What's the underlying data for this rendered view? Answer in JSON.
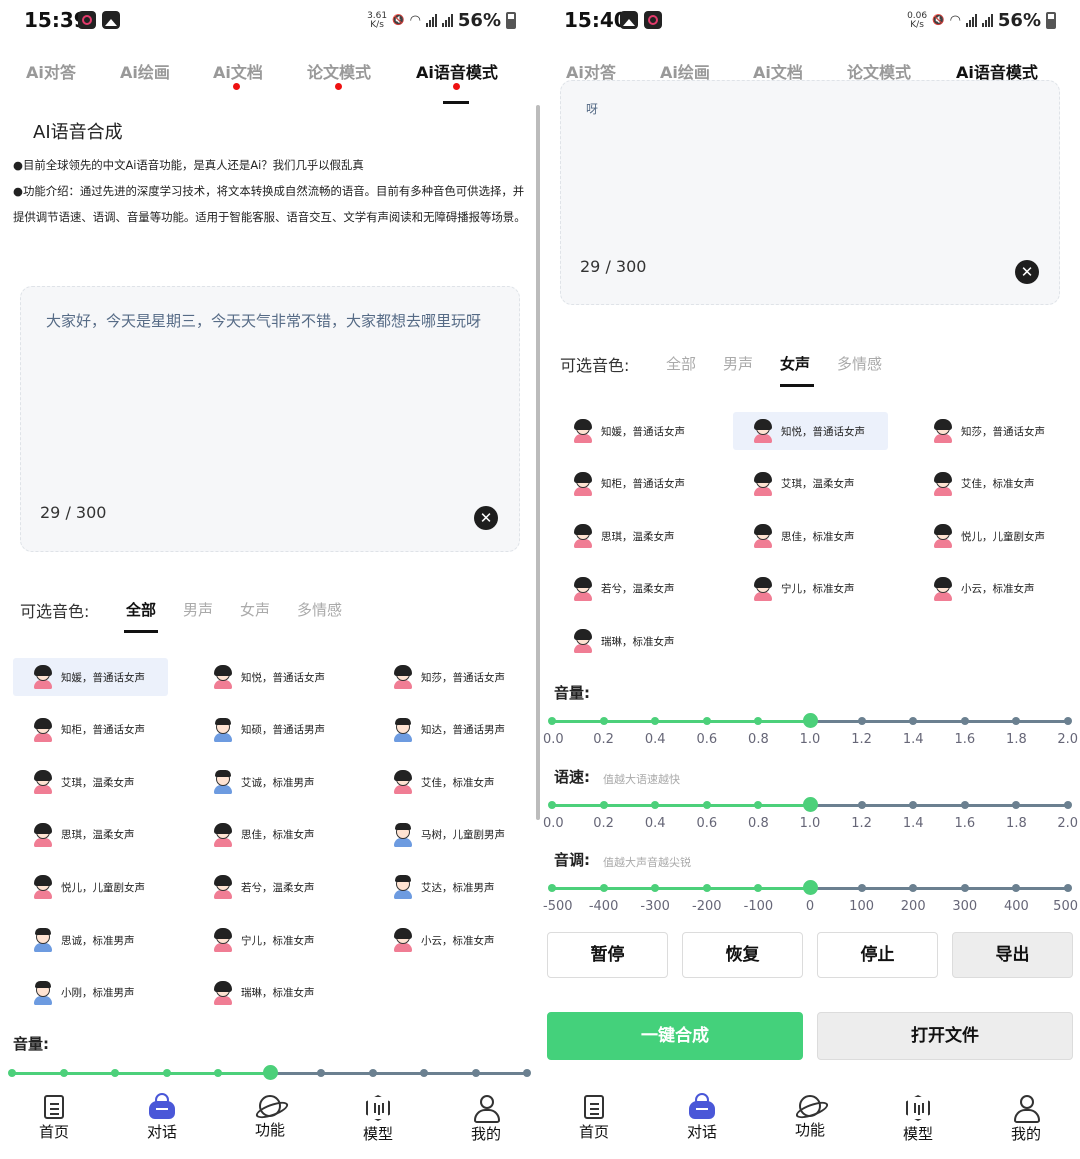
{
  "colors": {
    "accent_green": "#44d17b",
    "dot_red": "#ee1111",
    "track": "#6b8090",
    "selected_bg": "#ecf1fb"
  },
  "icons": [
    "app-icon",
    "gallery-icon",
    "mute-icon",
    "wifi-icon",
    "signal-icon",
    "battery-icon",
    "clear-icon",
    "file-icon",
    "bag-icon",
    "planet-icon",
    "hexagon-icon",
    "user-icon",
    "avatar-icon"
  ],
  "nav_tabs": [
    "Ai对答",
    "Ai绘画",
    "Ai文档",
    "论文模式",
    "Ai语音模式"
  ],
  "bottom_nav": [
    "首页",
    "对话",
    "功能",
    "模型",
    "我的"
  ],
  "voice_filter_label": "可选音色:",
  "voice_tabs": [
    "全部",
    "男声",
    "女声",
    "多情感"
  ],
  "left": {
    "status": {
      "time": "15:39",
      "speed": "3.61",
      "speed_unit": "K/s",
      "battery": "56%"
    },
    "heading": "AI语音合成",
    "intro_line1": "●目前全球领先的中文Ai语音功能，是真人还是Ai？我们几乎以假乱真",
    "intro_line2": "●功能介绍：通过先进的深度学习技术，将文本转换成自然流畅的语音。目前有多种音色可供选择，并提供调节语速、语调、音量等功能。适用于智能客服、语音交互、文学有声阅读和无障碍播报等场景。",
    "text_content": "大家好，今天是星期三，今天天气非常不错，大家都想去哪里玩呀",
    "char_count": "29 / 300",
    "active_voice_tab": "全部",
    "voices": [
      {
        "name": "知媛，普通话女声",
        "gender": "f",
        "selected": true
      },
      {
        "name": "知悦，普通话女声",
        "gender": "f"
      },
      {
        "name": "知莎，普通话女声",
        "gender": "f"
      },
      {
        "name": "知柜，普通话女声",
        "gender": "f"
      },
      {
        "name": "知硕，普通话男声",
        "gender": "m"
      },
      {
        "name": "知达，普通话男声",
        "gender": "m"
      },
      {
        "name": "艾琪，温柔女声",
        "gender": "f"
      },
      {
        "name": "艾诚，标准男声",
        "gender": "m"
      },
      {
        "name": "艾佳，标准女声",
        "gender": "f"
      },
      {
        "name": "思琪，温柔女声",
        "gender": "f"
      },
      {
        "name": "思佳，标准女声",
        "gender": "f"
      },
      {
        "name": "马树，儿童剧男声",
        "gender": "m"
      },
      {
        "name": "悦儿，儿童剧女声",
        "gender": "f"
      },
      {
        "name": "若兮，温柔女声",
        "gender": "f"
      },
      {
        "name": "艾达，标准男声",
        "gender": "m"
      },
      {
        "name": "思诚，标准男声",
        "gender": "m"
      },
      {
        "name": "宁儿，标准女声",
        "gender": "f"
      },
      {
        "name": "小云，标准女声",
        "gender": "f"
      },
      {
        "name": "小刚，标准男声",
        "gender": "m"
      },
      {
        "name": "瑞琳，标准女声",
        "gender": "f"
      }
    ],
    "volume_label": "音量:",
    "volume_value": 1.0
  },
  "right": {
    "status": {
      "time": "15:40",
      "speed": "0.06",
      "speed_unit": "K/s",
      "battery": "56%"
    },
    "text_fragment": "呀",
    "char_count": "29 / 300",
    "active_voice_tab": "女声",
    "voices": [
      {
        "name": "知媛，普通话女声",
        "gender": "f"
      },
      {
        "name": "知悦，普通话女声",
        "gender": "f",
        "selected": true
      },
      {
        "name": "知莎，普通话女声",
        "gender": "f"
      },
      {
        "name": "知柜，普通话女声",
        "gender": "f"
      },
      {
        "name": "艾琪，温柔女声",
        "gender": "f"
      },
      {
        "name": "艾佳，标准女声",
        "gender": "f"
      },
      {
        "name": "思琪，温柔女声",
        "gender": "f"
      },
      {
        "name": "思佳，标准女声",
        "gender": "f"
      },
      {
        "name": "悦儿，儿童剧女声",
        "gender": "f"
      },
      {
        "name": "若兮，温柔女声",
        "gender": "f"
      },
      {
        "name": "宁儿，标准女声",
        "gender": "f"
      },
      {
        "name": "小云，标准女声",
        "gender": "f"
      },
      {
        "name": "瑞琳，标准女声",
        "gender": "f"
      }
    ],
    "sliders": [
      {
        "key": "volume",
        "label": "音量:",
        "hint": "",
        "min": 0,
        "max": 2,
        "value": 1.0,
        "ticks": [
          "0.0",
          "0.2",
          "0.4",
          "0.6",
          "0.8",
          "1.0",
          "1.2",
          "1.4",
          "1.6",
          "1.8",
          "2.0"
        ]
      },
      {
        "key": "speed",
        "label": "语速:",
        "hint": "值越大语速越快",
        "min": 0,
        "max": 2,
        "value": 1.0,
        "ticks": [
          "0.0",
          "0.2",
          "0.4",
          "0.6",
          "0.8",
          "1.0",
          "1.2",
          "1.4",
          "1.6",
          "1.8",
          "2.0"
        ]
      },
      {
        "key": "pitch",
        "label": "音调:",
        "hint": "值越大声音越尖锐",
        "min": -500,
        "max": 500,
        "value": 0,
        "ticks": [
          "-500",
          "-400",
          "-300",
          "-200",
          "-100",
          "0",
          "100",
          "200",
          "300",
          "400",
          "500"
        ]
      }
    ],
    "buttons": {
      "pause": "暂停",
      "resume": "恢复",
      "stop": "停止",
      "export": "导出",
      "synthesize": "一键合成",
      "open_file": "打开文件"
    }
  }
}
